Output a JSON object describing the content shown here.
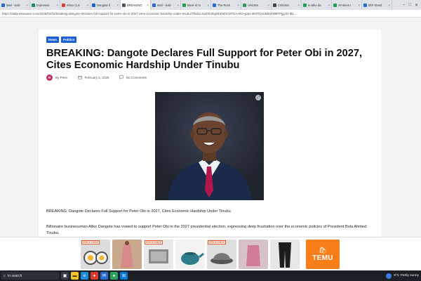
{
  "browser": {
    "tabs": [
      {
        "label": "Mail - Safv",
        "color": "#2b6cd1",
        "active": false
      },
      {
        "label": "Expressio",
        "color": "#1f8a5a",
        "active": false
      },
      {
        "label": "Inbox (1,6",
        "color": "#d14836",
        "active": false
      },
      {
        "label": "Dangote fi",
        "color": "#1f5fd6",
        "active": false
      },
      {
        "label": "BREAKING",
        "color": "#555555",
        "active": true
      },
      {
        "label": "Mail - Safv",
        "color": "#2b6cd1",
        "active": false
      },
      {
        "label": "Book of m",
        "color": "#2a9d5b",
        "active": false
      },
      {
        "label": "The Rock",
        "color": "#2b6cd1",
        "active": false
      },
      {
        "label": "criticism",
        "color": "#2a9d5b",
        "active": false
      },
      {
        "label": "Criticism",
        "color": "#444444",
        "active": false
      },
      {
        "label": "is aliko da",
        "color": "#2a9d5b",
        "active": false
      },
      {
        "label": "29 times t",
        "color": "#2a9d5b",
        "active": false
      },
      {
        "label": "BOI Stand",
        "color": "#2b6cd1",
        "active": false
      }
    ],
    "url": "https://dailynewswave.com/2025/02/02/breaking-dangote-declares-full-support-for-peter-obi-in-2027-cites-economic-hardship-under-tinubu/?fbclid=IwZXh0bgNhZW0CMTEAAR3-ypps-i5NFlOsUBkIW8l8PiPjjgJO-lB1..."
  },
  "article": {
    "categories": [
      "News",
      "Politics"
    ],
    "title": "BREAKING: Dangote Declares Full Support for Peter Obi in 2027, Cites Economic Hardship Under Tinubu",
    "author_initial": "R",
    "author": "By Peter",
    "date": "February 2, 2025",
    "comments": "No Comments",
    "paragraph1": "BREAKING: Dangote Declares Full Support for Peter Obi in 2027, Cites Economic Hardship Under Tinubu",
    "paragraph2": "Billionaire businessman Aliko Dangote has vowed to support Peter Obi in the 2027 presidential election, expressing deep frustration over the economic policies of President Bola Ahmed Tinubu."
  },
  "ad": {
    "badge_text": "PRICE DROP",
    "brand": "TEMU",
    "brand_icon": "🛍"
  },
  "taskbar": {
    "search_placeholder": "to search",
    "weather": "8°C  Partly sunny"
  },
  "colors": {
    "accent": "#1f5fd6",
    "temu": "#f77e18",
    "taskbar": "#1c1f26"
  }
}
